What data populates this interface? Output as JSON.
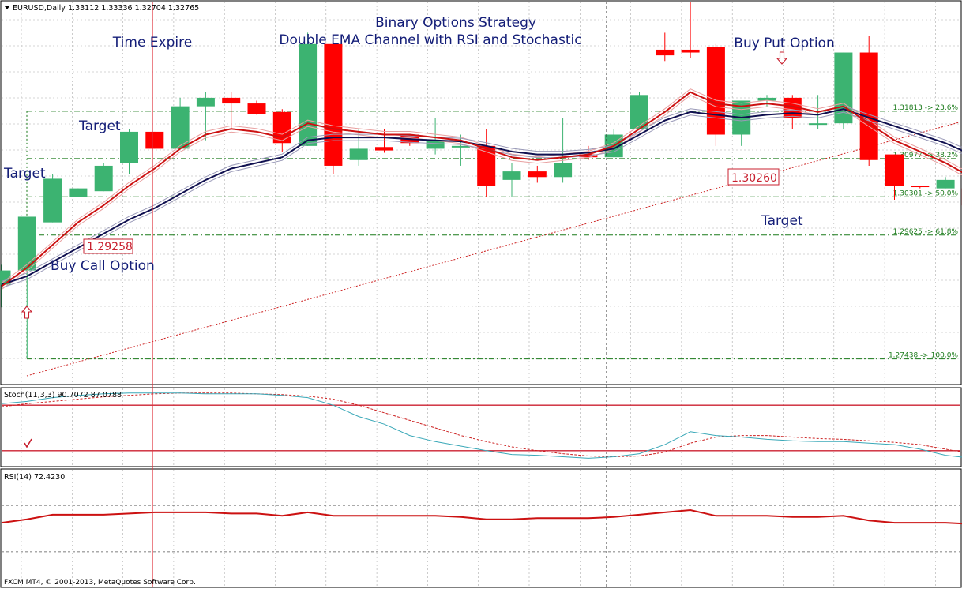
{
  "chart_header": {
    "symbol": "EURUSD,Daily",
    "ohlc": "1.33112 1.33336 1.32704 1.32765",
    "stoch_label": "Stoch(11,3,3) 90.7072 87.0788",
    "rsi_label": "RSI(14) 72.4230",
    "footer": "FXCM MT4, © 2001-2013, MetaQuotes Software Corp."
  },
  "annotations": {
    "title_line1": "Binary Options Strategy",
    "title_line2": "Double EMA Channel with RSI and Stochastic",
    "time_expire": "Time Expire",
    "target1": "Target",
    "target2": "Target",
    "target3": "Target",
    "buy_call": "Buy Call Option",
    "buy_put": "Buy Put Option",
    "price_label_call": "1.29258",
    "price_label_put": "1.30260"
  },
  "colors": {
    "bull": "#3cb371",
    "bear": "#ff0000",
    "ema_fast": "#cc1111",
    "ema_slow": "#101050",
    "fib": "#1a7a1a",
    "stoch_main": "#3aa8b8",
    "stoch_signal": "#cc2222",
    "rsi": "#cc1111",
    "grid": "#aaaaaa"
  },
  "chart_data": {
    "type": "candlestick",
    "price_range": [
      1.27,
      1.3375
    ],
    "fib_levels": [
      {
        "price": 1.31813,
        "label": "1.31813 -> 23.6%"
      },
      {
        "price": 1.30977,
        "label": "1.30977 -> 38.2%"
      },
      {
        "price": 1.30301,
        "label": "1.30301 -> 50.0%"
      },
      {
        "price": 1.29625,
        "label": "1.29625 -> 61.8%"
      },
      {
        "price": 1.27438,
        "label": "1.27438 -> 100.0%"
      }
    ],
    "candles": [
      {
        "o": 1.2875,
        "h": 1.291,
        "l": 1.2835,
        "c": 1.29
      },
      {
        "o": 1.29,
        "h": 1.2975,
        "l": 1.2745,
        "c": 1.2995
      },
      {
        "o": 1.2985,
        "h": 1.307,
        "l": 1.2985,
        "c": 1.3062
      },
      {
        "o": 1.303,
        "h": 1.3045,
        "l": 1.303,
        "c": 1.3045
      },
      {
        "o": 1.304,
        "h": 1.309,
        "l": 1.304,
        "c": 1.3085
      },
      {
        "o": 1.309,
        "h": 1.315,
        "l": 1.307,
        "c": 1.3145
      },
      {
        "o": 1.3145,
        "h": 1.3145,
        "l": 1.3115,
        "c": 1.3115
      },
      {
        "o": 1.3115,
        "h": 1.3205,
        "l": 1.3115,
        "c": 1.319
      },
      {
        "o": 1.319,
        "h": 1.3215,
        "l": 1.313,
        "c": 1.3205
      },
      {
        "o": 1.3205,
        "h": 1.3215,
        "l": 1.315,
        "c": 1.3195
      },
      {
        "o": 1.3195,
        "h": 1.32,
        "l": 1.3175,
        "c": 1.3176
      },
      {
        "o": 1.318,
        "h": 1.3185,
        "l": 1.311,
        "c": 1.3125
      },
      {
        "o": 1.312,
        "h": 1.332,
        "l": 1.312,
        "c": 1.33
      },
      {
        "o": 1.33,
        "h": 1.33,
        "l": 1.307,
        "c": 1.3085
      },
      {
        "o": 1.3095,
        "h": 1.315,
        "l": 1.3085,
        "c": 1.3115
      },
      {
        "o": 1.3118,
        "h": 1.315,
        "l": 1.3108,
        "c": 1.3112
      },
      {
        "o": 1.314,
        "h": 1.314,
        "l": 1.312,
        "c": 1.3125
      },
      {
        "o": 1.3115,
        "h": 1.317,
        "l": 1.3105,
        "c": 1.313
      },
      {
        "o": 1.312,
        "h": 1.314,
        "l": 1.3085,
        "c": 1.312
      },
      {
        "o": 1.312,
        "h": 1.315,
        "l": 1.303,
        "c": 1.305
      },
      {
        "o": 1.306,
        "h": 1.309,
        "l": 1.303,
        "c": 1.3075
      },
      {
        "o": 1.3075,
        "h": 1.3085,
        "l": 1.3055,
        "c": 1.3065
      },
      {
        "o": 1.3065,
        "h": 1.317,
        "l": 1.3055,
        "c": 1.309
      },
      {
        "o": 1.3105,
        "h": 1.312,
        "l": 1.3095,
        "c": 1.31
      },
      {
        "o": 1.31,
        "h": 1.315,
        "l": 1.31,
        "c": 1.314
      },
      {
        "o": 1.315,
        "h": 1.3215,
        "l": 1.315,
        "c": 1.321
      },
      {
        "o": 1.329,
        "h": 1.332,
        "l": 1.327,
        "c": 1.328
      },
      {
        "o": 1.329,
        "h": 1.3375,
        "l": 1.3275,
        "c": 1.3285
      },
      {
        "o": 1.3295,
        "h": 1.33,
        "l": 1.312,
        "c": 1.314
      },
      {
        "o": 1.314,
        "h": 1.32,
        "l": 1.312,
        "c": 1.32
      },
      {
        "o": 1.32,
        "h": 1.321,
        "l": 1.319,
        "c": 1.3205
      },
      {
        "o": 1.3205,
        "h": 1.321,
        "l": 1.315,
        "c": 1.317
      },
      {
        "o": 1.316,
        "h": 1.321,
        "l": 1.315,
        "c": 1.316
      },
      {
        "o": 1.316,
        "h": 1.3285,
        "l": 1.315,
        "c": 1.3285
      },
      {
        "o": 1.3285,
        "h": 1.3315,
        "l": 1.3085,
        "c": 1.3095
      },
      {
        "o": 1.3105,
        "h": 1.3105,
        "l": 1.3025,
        "c": 1.305
      },
      {
        "o": 1.305,
        "h": 1.305,
        "l": 1.3045,
        "c": 1.3048
      },
      {
        "o": 1.3045,
        "h": 1.3065,
        "l": 1.3045,
        "c": 1.306
      },
      {
        "o": 1.3045,
        "h": 1.306,
        "l": 1.3015,
        "c": 1.3015
      },
      {
        "o": 1.302,
        "h": 1.302,
        "l": 1.297,
        "c": 1.298
      },
      {
        "o": 1.296,
        "h": 1.296,
        "l": 1.296,
        "c": 1.296
      }
    ],
    "ema_fast": [
      1.2872,
      1.2905,
      1.2945,
      1.2985,
      1.3015,
      1.305,
      1.308,
      1.3115,
      1.314,
      1.315,
      1.3145,
      1.3135,
      1.316,
      1.315,
      1.3145,
      1.314,
      1.314,
      1.3135,
      1.313,
      1.3115,
      1.31,
      1.3095,
      1.31,
      1.3105,
      1.312,
      1.315,
      1.318,
      1.3215,
      1.3195,
      1.319,
      1.3195,
      1.319,
      1.318,
      1.319,
      1.316,
      1.313,
      1.311,
      1.309,
      1.3065,
      1.3035,
      1.301
    ],
    "ema_slow": [
      1.2875,
      1.289,
      1.2915,
      1.294,
      1.2965,
      1.299,
      1.301,
      1.3035,
      1.306,
      1.308,
      1.309,
      1.31,
      1.313,
      1.3135,
      1.3135,
      1.3135,
      1.3132,
      1.313,
      1.3128,
      1.312,
      1.311,
      1.3105,
      1.3105,
      1.3108,
      1.3115,
      1.314,
      1.3165,
      1.318,
      1.3175,
      1.317,
      1.3175,
      1.3178,
      1.3175,
      1.3185,
      1.317,
      1.3155,
      1.314,
      1.3125,
      1.3105,
      1.308,
      1.306
    ],
    "stochastic": {
      "main": [
        82,
        85,
        90,
        93,
        95,
        96,
        96,
        96,
        95,
        95,
        95,
        93,
        90,
        80,
        65,
        55,
        40,
        32,
        26,
        20,
        15,
        14,
        12,
        10,
        12,
        16,
        28,
        45,
        40,
        38,
        35,
        33,
        32,
        32,
        30,
        28,
        22,
        14,
        10,
        8,
        6
      ],
      "signal": [
        78,
        82,
        85,
        88,
        91,
        93,
        95,
        96,
        96,
        96,
        95,
        94,
        92,
        88,
        80,
        70,
        60,
        50,
        40,
        32,
        25,
        20,
        16,
        13,
        12,
        13,
        18,
        30,
        38,
        40,
        40,
        38,
        36,
        35,
        33,
        31,
        28,
        22,
        16,
        12,
        8
      ],
      "levels": [
        80,
        20
      ]
    },
    "rsi": {
      "values": [
        55,
        58,
        62,
        62,
        62,
        63,
        64,
        64,
        64,
        63,
        63,
        61,
        64,
        61,
        61,
        61,
        61,
        61,
        60,
        58,
        58,
        59,
        59,
        59,
        60,
        62,
        64,
        66,
        61,
        61,
        61,
        60,
        60,
        61,
        57,
        55,
        55,
        55,
        54,
        52,
        52
      ],
      "levels": [
        70,
        30
      ]
    }
  }
}
